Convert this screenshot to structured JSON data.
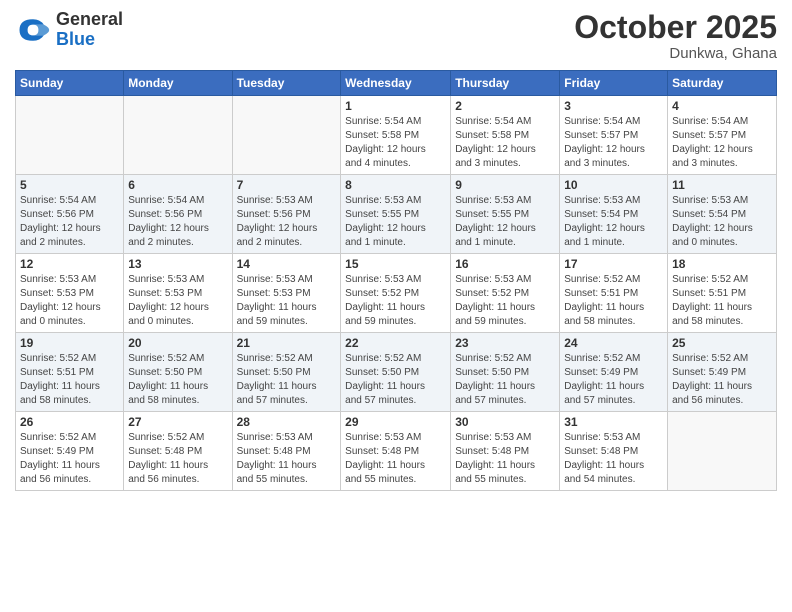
{
  "header": {
    "logo": {
      "general": "General",
      "blue": "Blue"
    },
    "month": "October 2025",
    "location": "Dunkwa, Ghana"
  },
  "weekdays": [
    "Sunday",
    "Monday",
    "Tuesday",
    "Wednesday",
    "Thursday",
    "Friday",
    "Saturday"
  ],
  "weeks": [
    [
      {
        "day": "",
        "info": ""
      },
      {
        "day": "",
        "info": ""
      },
      {
        "day": "",
        "info": ""
      },
      {
        "day": "1",
        "info": "Sunrise: 5:54 AM\nSunset: 5:58 PM\nDaylight: 12 hours\nand 4 minutes."
      },
      {
        "day": "2",
        "info": "Sunrise: 5:54 AM\nSunset: 5:58 PM\nDaylight: 12 hours\nand 3 minutes."
      },
      {
        "day": "3",
        "info": "Sunrise: 5:54 AM\nSunset: 5:57 PM\nDaylight: 12 hours\nand 3 minutes."
      },
      {
        "day": "4",
        "info": "Sunrise: 5:54 AM\nSunset: 5:57 PM\nDaylight: 12 hours\nand 3 minutes."
      }
    ],
    [
      {
        "day": "5",
        "info": "Sunrise: 5:54 AM\nSunset: 5:56 PM\nDaylight: 12 hours\nand 2 minutes."
      },
      {
        "day": "6",
        "info": "Sunrise: 5:54 AM\nSunset: 5:56 PM\nDaylight: 12 hours\nand 2 minutes."
      },
      {
        "day": "7",
        "info": "Sunrise: 5:53 AM\nSunset: 5:56 PM\nDaylight: 12 hours\nand 2 minutes."
      },
      {
        "day": "8",
        "info": "Sunrise: 5:53 AM\nSunset: 5:55 PM\nDaylight: 12 hours\nand 1 minute."
      },
      {
        "day": "9",
        "info": "Sunrise: 5:53 AM\nSunset: 5:55 PM\nDaylight: 12 hours\nand 1 minute."
      },
      {
        "day": "10",
        "info": "Sunrise: 5:53 AM\nSunset: 5:54 PM\nDaylight: 12 hours\nand 1 minute."
      },
      {
        "day": "11",
        "info": "Sunrise: 5:53 AM\nSunset: 5:54 PM\nDaylight: 12 hours\nand 0 minutes."
      }
    ],
    [
      {
        "day": "12",
        "info": "Sunrise: 5:53 AM\nSunset: 5:53 PM\nDaylight: 12 hours\nand 0 minutes."
      },
      {
        "day": "13",
        "info": "Sunrise: 5:53 AM\nSunset: 5:53 PM\nDaylight: 12 hours\nand 0 minutes."
      },
      {
        "day": "14",
        "info": "Sunrise: 5:53 AM\nSunset: 5:53 PM\nDaylight: 11 hours\nand 59 minutes."
      },
      {
        "day": "15",
        "info": "Sunrise: 5:53 AM\nSunset: 5:52 PM\nDaylight: 11 hours\nand 59 minutes."
      },
      {
        "day": "16",
        "info": "Sunrise: 5:53 AM\nSunset: 5:52 PM\nDaylight: 11 hours\nand 59 minutes."
      },
      {
        "day": "17",
        "info": "Sunrise: 5:52 AM\nSunset: 5:51 PM\nDaylight: 11 hours\nand 58 minutes."
      },
      {
        "day": "18",
        "info": "Sunrise: 5:52 AM\nSunset: 5:51 PM\nDaylight: 11 hours\nand 58 minutes."
      }
    ],
    [
      {
        "day": "19",
        "info": "Sunrise: 5:52 AM\nSunset: 5:51 PM\nDaylight: 11 hours\nand 58 minutes."
      },
      {
        "day": "20",
        "info": "Sunrise: 5:52 AM\nSunset: 5:50 PM\nDaylight: 11 hours\nand 58 minutes."
      },
      {
        "day": "21",
        "info": "Sunrise: 5:52 AM\nSunset: 5:50 PM\nDaylight: 11 hours\nand 57 minutes."
      },
      {
        "day": "22",
        "info": "Sunrise: 5:52 AM\nSunset: 5:50 PM\nDaylight: 11 hours\nand 57 minutes."
      },
      {
        "day": "23",
        "info": "Sunrise: 5:52 AM\nSunset: 5:50 PM\nDaylight: 11 hours\nand 57 minutes."
      },
      {
        "day": "24",
        "info": "Sunrise: 5:52 AM\nSunset: 5:49 PM\nDaylight: 11 hours\nand 57 minutes."
      },
      {
        "day": "25",
        "info": "Sunrise: 5:52 AM\nSunset: 5:49 PM\nDaylight: 11 hours\nand 56 minutes."
      }
    ],
    [
      {
        "day": "26",
        "info": "Sunrise: 5:52 AM\nSunset: 5:49 PM\nDaylight: 11 hours\nand 56 minutes."
      },
      {
        "day": "27",
        "info": "Sunrise: 5:52 AM\nSunset: 5:48 PM\nDaylight: 11 hours\nand 56 minutes."
      },
      {
        "day": "28",
        "info": "Sunrise: 5:53 AM\nSunset: 5:48 PM\nDaylight: 11 hours\nand 55 minutes."
      },
      {
        "day": "29",
        "info": "Sunrise: 5:53 AM\nSunset: 5:48 PM\nDaylight: 11 hours\nand 55 minutes."
      },
      {
        "day": "30",
        "info": "Sunrise: 5:53 AM\nSunset: 5:48 PM\nDaylight: 11 hours\nand 55 minutes."
      },
      {
        "day": "31",
        "info": "Sunrise: 5:53 AM\nSunset: 5:48 PM\nDaylight: 11 hours\nand 54 minutes."
      },
      {
        "day": "",
        "info": ""
      }
    ]
  ]
}
